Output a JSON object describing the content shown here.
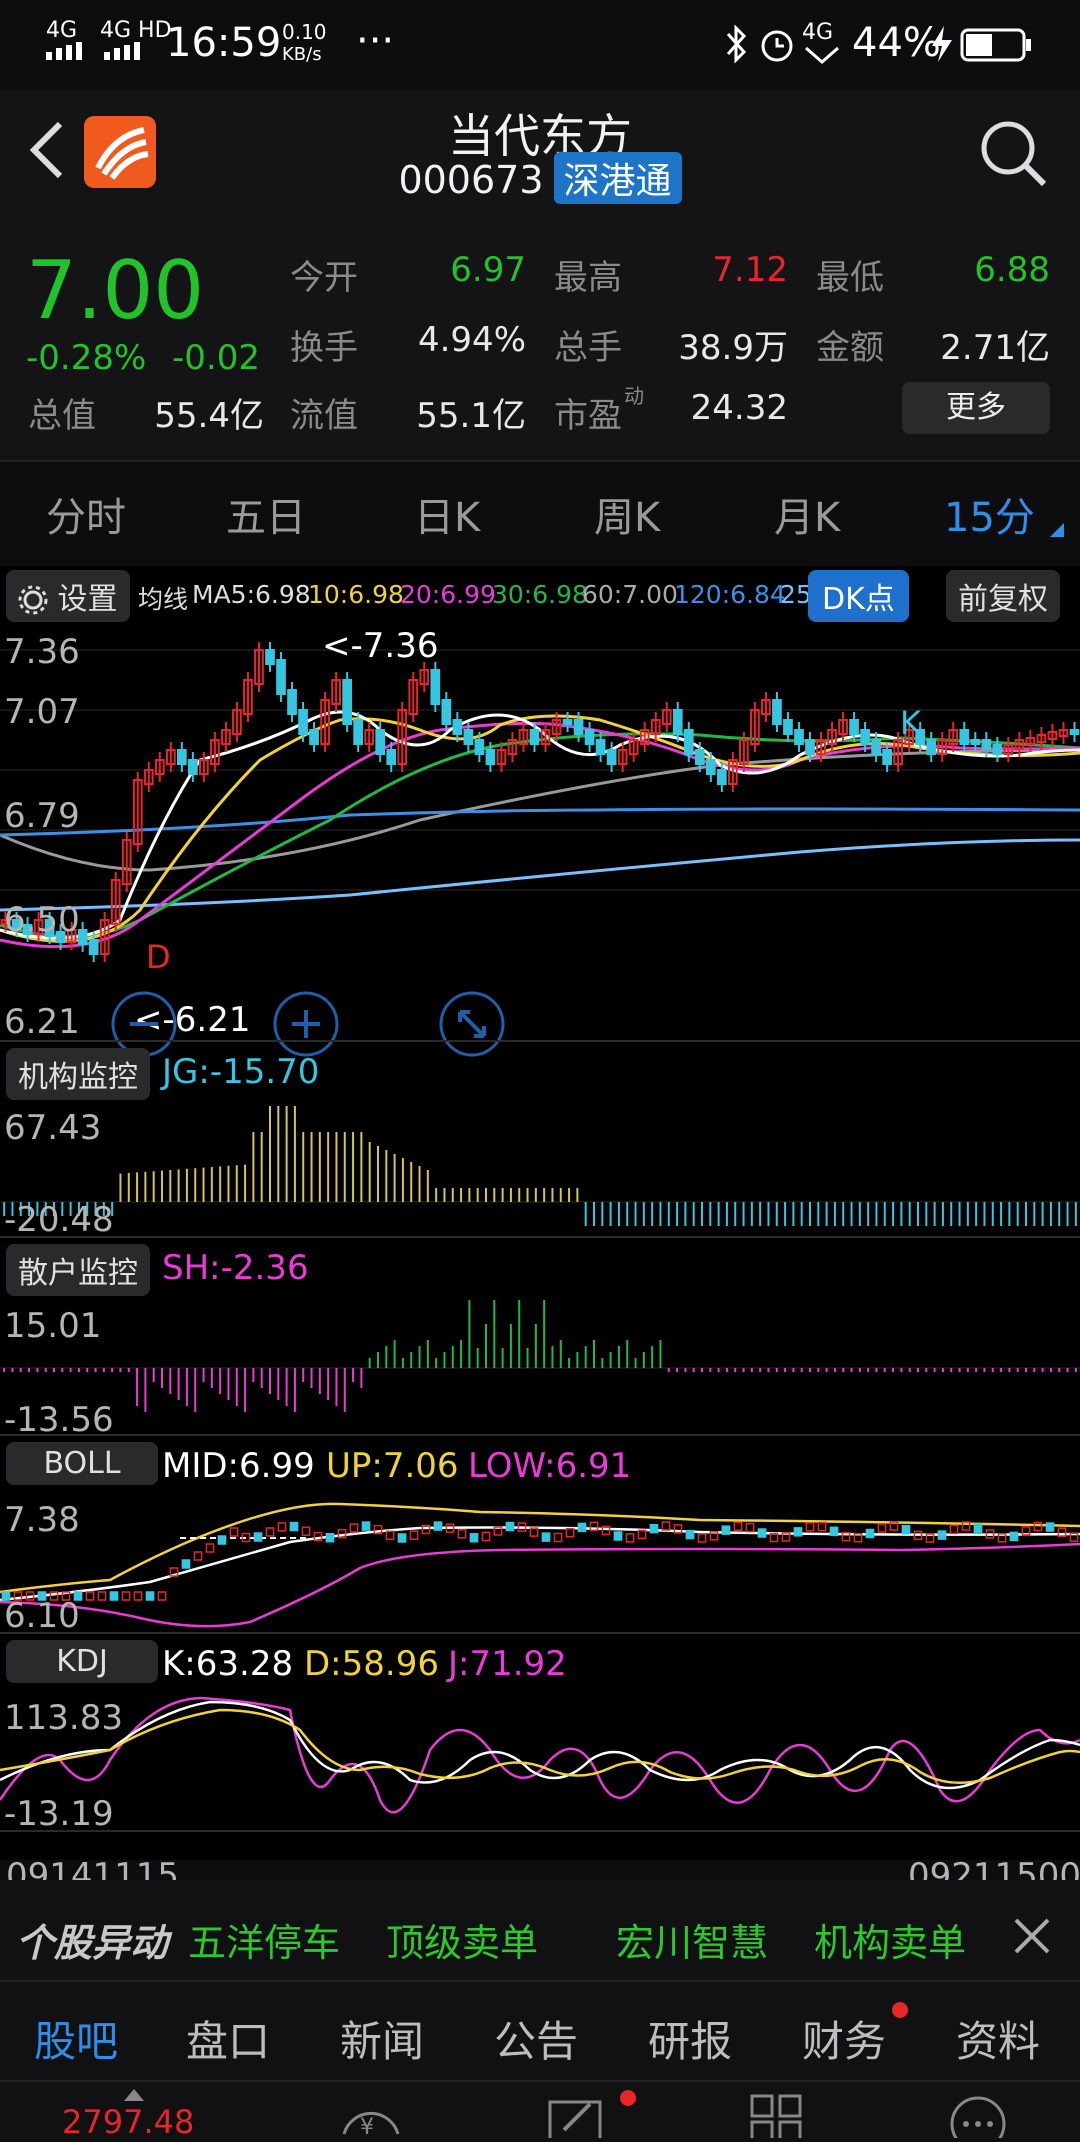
{
  "status": {
    "network1": "4G",
    "network2": "4G HD",
    "time": "16:59",
    "speed_val": "0.10",
    "speed_unit": "KB/s",
    "dots": "···",
    "net3": "4G",
    "battery": "44%"
  },
  "header": {
    "name": "当代东方",
    "code": "000673",
    "badge": "深港通"
  },
  "quote": {
    "price": "7.00",
    "pct": "-0.28%",
    "chg": "-0.02",
    "open_l": "今开",
    "open_v": "6.97",
    "high_l": "最高",
    "high_v": "7.12",
    "low_l": "最低",
    "low_v": "6.88",
    "turn_l": "换手",
    "turn_v": "4.94%",
    "vol_l": "总手",
    "vol_v": "38.9万",
    "amt_l": "金额",
    "amt_v": "2.71亿",
    "cap_l": "总值",
    "cap_v": "55.4亿",
    "flow_l": "流值",
    "flow_v": "55.1亿",
    "pe_l": "市盈",
    "pe_sup": "动",
    "pe_v": "24.32",
    "more": "更多"
  },
  "tabs": {
    "t1": "分时",
    "t2": "五日",
    "t3": "日K",
    "t4": "周K",
    "t5": "月K",
    "t6": "15分"
  },
  "chart": {
    "settings": "设置",
    "ma_label": "均线",
    "ma5": "MA5:6.98",
    "ma10": "10:6.98",
    "ma20": "20:6.99",
    "ma30": "30:6.98",
    "ma60": "60:7.00",
    "ma120": "120:6.84",
    "ma250": "25",
    "dk": "DK点",
    "fq": "前复权",
    "y1": "7.36",
    "y2": "7.07",
    "y3": "6.79",
    "y4": "6.50",
    "y5": "6.21",
    "hi_mark": "<-7.36",
    "lo_mark": "<-6.21",
    "d_mark": "D",
    "k_mark": "K",
    "jg_btn": "机构监控",
    "jg_val": "JG:-15.70",
    "jg_top": "67.43",
    "jg_bot": "-20.48",
    "sh_btn": "散户监控",
    "sh_val": "SH:-2.36",
    "sh_top": "15.01",
    "sh_bot": "-13.56",
    "boll_btn": "BOLL",
    "boll_mid": "MID:6.99",
    "boll_up": "UP:7.06",
    "boll_low": "LOW:6.91",
    "boll_top": "7.38",
    "boll_bot": "6.10",
    "kdj_btn": "KDJ",
    "kdj_k": "K:63.28",
    "kdj_d": "D:58.96",
    "kdj_j": "J:71.92",
    "kdj_top": "113.83",
    "kdj_bot": "-13.19",
    "date_left": "09141115",
    "date_right": "09211500"
  },
  "ticker": {
    "logo": "个股异动",
    "i1": "五洋停车",
    "i2": "顶级卖单",
    "i3": "宏川智慧",
    "i4": "机构卖单"
  },
  "bottom_tabs": {
    "b1": "股吧",
    "b2": "盘口",
    "b3": "新闻",
    "b4": "公告",
    "b5": "研报",
    "b6": "财务",
    "b7": "资料"
  },
  "bottom_bar": {
    "index": "2797.48"
  }
}
